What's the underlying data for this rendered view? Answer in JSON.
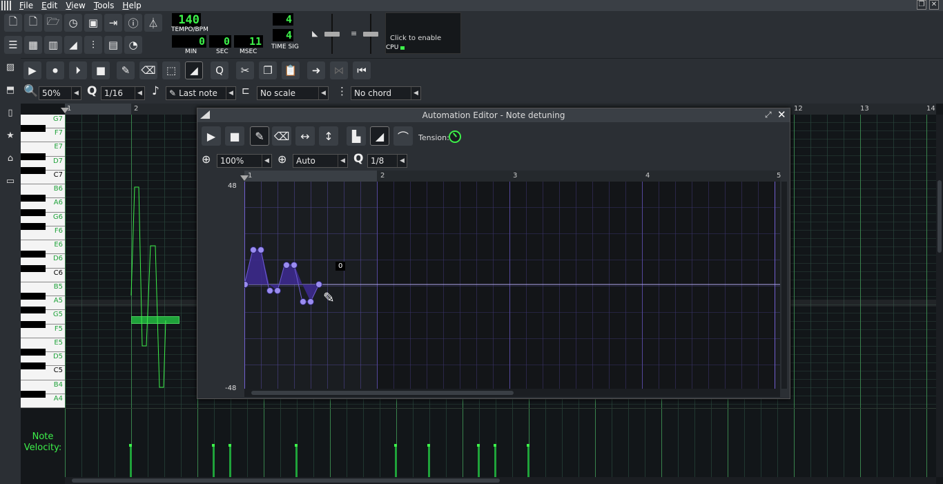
{
  "menu": [
    "File",
    "Edit",
    "View",
    "Tools",
    "Help"
  ],
  "transport": {
    "tempo": "140",
    "tempo_label": "TEMPO/BPM",
    "min": "0",
    "sec": "0",
    "msec": "11",
    "min_label": "MIN",
    "sec_label": "SEC",
    "msec_label": "MSEC",
    "timesig_num": "4",
    "timesig_den": "4",
    "timesig_label": "TIME SIG",
    "cpu_label": "CPU",
    "click_to_enable": "Click to enable"
  },
  "piano_roll": {
    "zoom": "50%",
    "quantize": "1/16",
    "note_length": "Last note",
    "scale": "No scale",
    "chord": "No chord",
    "timeline_numbers": [
      "1",
      "2",
      "12",
      "13",
      "14"
    ],
    "keys": [
      "G7",
      "F7",
      "E7",
      "D7",
      "C7",
      "B6",
      "A6",
      "G6",
      "F6",
      "E6",
      "D6",
      "C6",
      "B5",
      "A5",
      "G5",
      "F5",
      "E5",
      "D5",
      "C5",
      "B4",
      "A4"
    ],
    "velocity_label_1": "Note",
    "velocity_label_2": "Velocity:"
  },
  "automation_editor": {
    "title": "Automation Editor - Note detuning",
    "tension_label": "Tension:",
    "zoom_x": "100%",
    "zoom_y": "Auto",
    "quantize": "1/8",
    "y_max": "48",
    "y_min": "-48",
    "value_tooltip": "0",
    "ruler_numbers": [
      "1",
      "2",
      "3",
      "4",
      "5"
    ],
    "curve_color": "#3c2a8c",
    "point_color": "#9a8cf0"
  },
  "colors": {
    "accent_green": "#3df04a",
    "lcd_bg": "#000000"
  }
}
